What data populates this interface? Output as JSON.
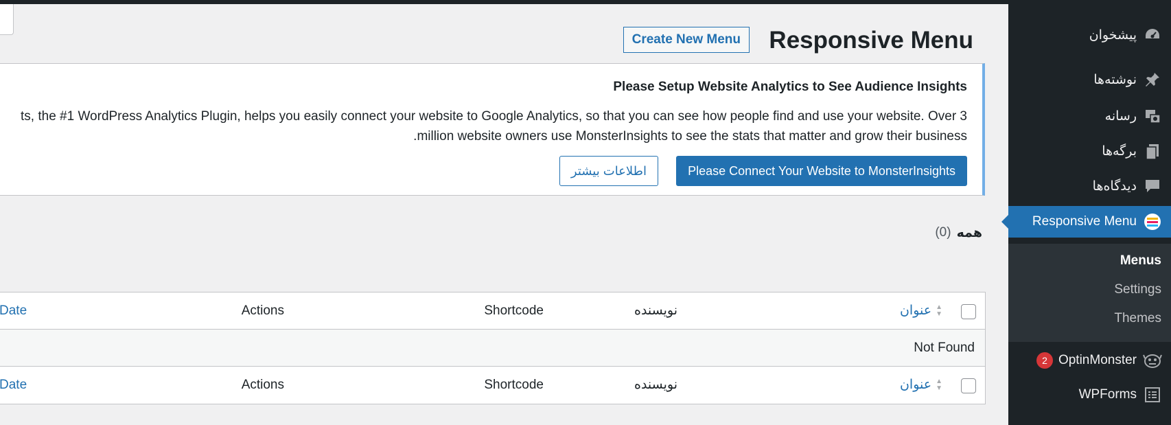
{
  "sidebar": {
    "items": [
      {
        "label": "پیشخوان",
        "icon": "dashboard-icon"
      },
      {
        "label": "نوشته‌ها",
        "icon": "pin-icon"
      },
      {
        "label": "رسانه",
        "icon": "media-icon"
      },
      {
        "label": "برگه‌ها",
        "icon": "pages-icon"
      },
      {
        "label": "دیدگاه‌ها",
        "icon": "comments-icon"
      },
      {
        "label": "Responsive Menu",
        "icon": "responsive-menu-icon",
        "active": true
      },
      {
        "label": "OptinMonster",
        "icon": "optinmonster-icon",
        "badge": "2"
      },
      {
        "label": "WPForms",
        "icon": "wpforms-icon"
      }
    ],
    "submenu": [
      {
        "label": "Menus",
        "current": true
      },
      {
        "label": "Settings"
      },
      {
        "label": "Themes"
      }
    ]
  },
  "header": {
    "title": "Responsive Menu",
    "create_button": "Create New Menu"
  },
  "notice": {
    "title": "Please Setup Website Analytics to See Audience Insights",
    "line1": "ts, the #1 WordPress Analytics Plugin, helps you easily connect your website to Google Analytics, so that you can see how people find and use your website. Over 3",
    "line2": "million website owners use MonsterInsights to see the stats that matter and grow their business.",
    "primary_button": "Please Connect Your Website to MonsterInsights",
    "secondary_button": "اطلاعات بیشتر"
  },
  "filter": {
    "all_label": "همه",
    "count": "(0)"
  },
  "table": {
    "columns": {
      "title": "عنوان",
      "author": "نویسنده",
      "shortcode": "Shortcode",
      "actions": "Actions",
      "date": "Date"
    },
    "empty_message": "Not Found"
  },
  "colors": {
    "accent": "#2271b1",
    "sidebar_bg": "#1d2327",
    "notice_border": "#72aee6",
    "badge": "#d63638"
  }
}
